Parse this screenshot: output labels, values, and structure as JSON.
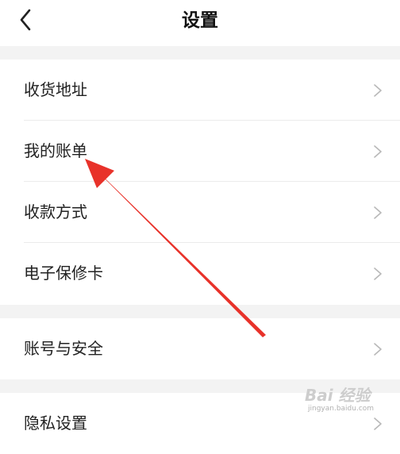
{
  "header": {
    "title": "设置",
    "back_icon": "chevron-left-icon"
  },
  "settings": {
    "items": [
      {
        "label": "收货地址",
        "icon": "chevron-right-icon"
      },
      {
        "label": "我的账单",
        "icon": "chevron-right-icon"
      },
      {
        "label": "收款方式",
        "icon": "chevron-right-icon"
      },
      {
        "label": "电子保修卡",
        "icon": "chevron-right-icon"
      },
      {
        "label": "账号与安全",
        "icon": "chevron-right-icon"
      },
      {
        "label": "隐私设置",
        "icon": "chevron-right-icon"
      }
    ]
  },
  "annotation": {
    "arrow_color": "#e8322a",
    "points_to": "我的账单"
  },
  "watermark": {
    "main": "Bai 经验",
    "sub": "jingyan.baidu.com"
  },
  "colors": {
    "background": "#ffffff",
    "separator": "#f3f3f3",
    "chevron": "#b8b8b8"
  }
}
